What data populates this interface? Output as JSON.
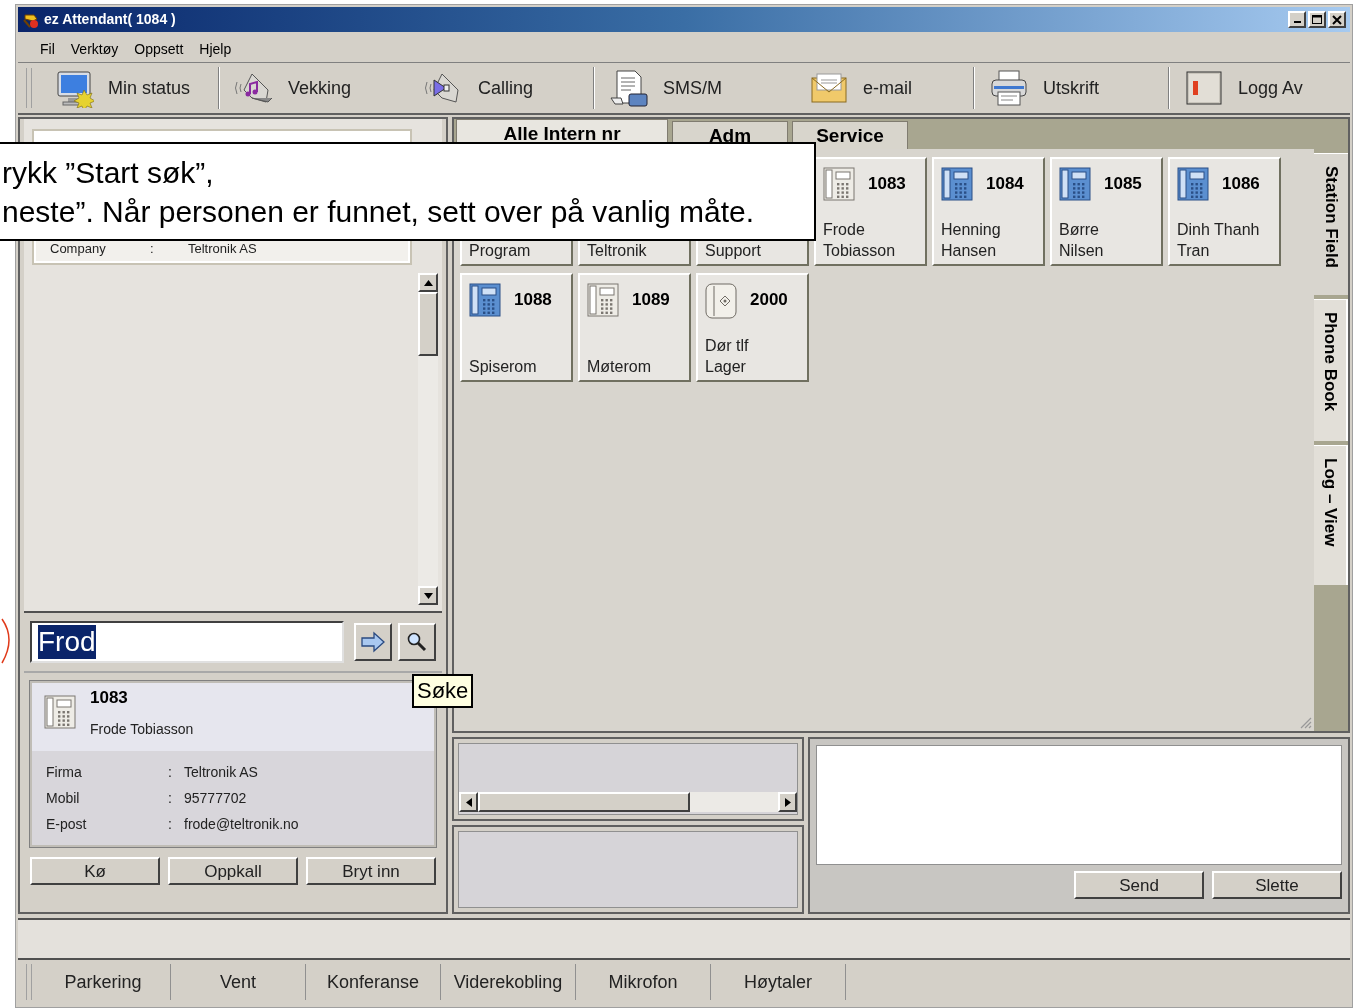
{
  "window": {
    "title": "ez Attendant( 1084 )"
  },
  "menu": [
    "Fil",
    "Verktøy",
    "Oppsett",
    "Hjelp"
  ],
  "toolbar_groups": [
    [
      {
        "label": "Min status",
        "kind": "status"
      }
    ],
    [
      {
        "label": "Vekking",
        "kind": "wakeup"
      },
      {
        "label": "Calling",
        "kind": "calling"
      }
    ],
    [
      {
        "label": "SMS/M",
        "kind": "sms"
      },
      {
        "label": "e-mail",
        "kind": "email"
      }
    ],
    [
      {
        "label": "Utskrift",
        "kind": "print"
      }
    ],
    [
      {
        "label": "Logg Av",
        "kind": "logoff"
      }
    ]
  ],
  "contact_list": {
    "card_rows": [
      {
        "label": "Company",
        "separator": ":",
        "value": "Teltronik AS"
      }
    ]
  },
  "search": {
    "value": "Frod",
    "tooltip": "Søke"
  },
  "selected_contact": {
    "number": "1083",
    "name": "Frode Tobiasson",
    "fields": [
      {
        "label": "Firma",
        "separator": ":",
        "value": "Teltronik AS"
      },
      {
        "label": "Mobil",
        "separator": ":",
        "value": "95777702"
      },
      {
        "label": "E-post",
        "separator": ":",
        "value": "frode@teltronik.no"
      }
    ]
  },
  "call_buttons": [
    "Kø",
    "Oppkall",
    "Bryt inn"
  ],
  "tabs": [
    {
      "label": "Alle Intern nr",
      "selected": true
    },
    {
      "label": "Adm",
      "selected": false
    },
    {
      "label": "Service",
      "selected": false
    }
  ],
  "stations": [
    {
      "name": "Program"
    },
    {
      "name": "Teltronik"
    },
    {
      "name": "Support"
    },
    {
      "number": "1083",
      "name": "Frode Tobiasson",
      "kind": "grey_phone"
    },
    {
      "number": "1084",
      "name": "Henning Hansen",
      "kind": "blue_phone"
    },
    {
      "number": "1085",
      "name": "Børre Nilsen",
      "kind": "blue_phone"
    },
    {
      "number": "1086",
      "name": "Dinh Thanh Tran",
      "kind": "blue_phone"
    },
    {
      "number": "1088",
      "name": "Spiserom",
      "kind": "blue_phone"
    },
    {
      "number": "1089",
      "name": "Møterom",
      "kind": "grey_phone"
    },
    {
      "number": "2000",
      "name": "Dør tlf Lager",
      "kind": "door_phone"
    }
  ],
  "side_tabs": [
    {
      "label": "Station Field",
      "selected": true
    },
    {
      "label": "Phone Book",
      "selected": false
    },
    {
      "label": "Log – View",
      "selected": false
    }
  ],
  "message_buttons": [
    "Send",
    "Slette"
  ],
  "bottom_toolbar": [
    "Parkering",
    "Vent",
    "Konferanse",
    "Viderekobling",
    "Mikrofon",
    "Høytaler"
  ],
  "callout": {
    "lines": [
      "rykk ”Start søk”,",
      "neste”. Når personen er funnet, sett over på vanlig måte."
    ]
  }
}
